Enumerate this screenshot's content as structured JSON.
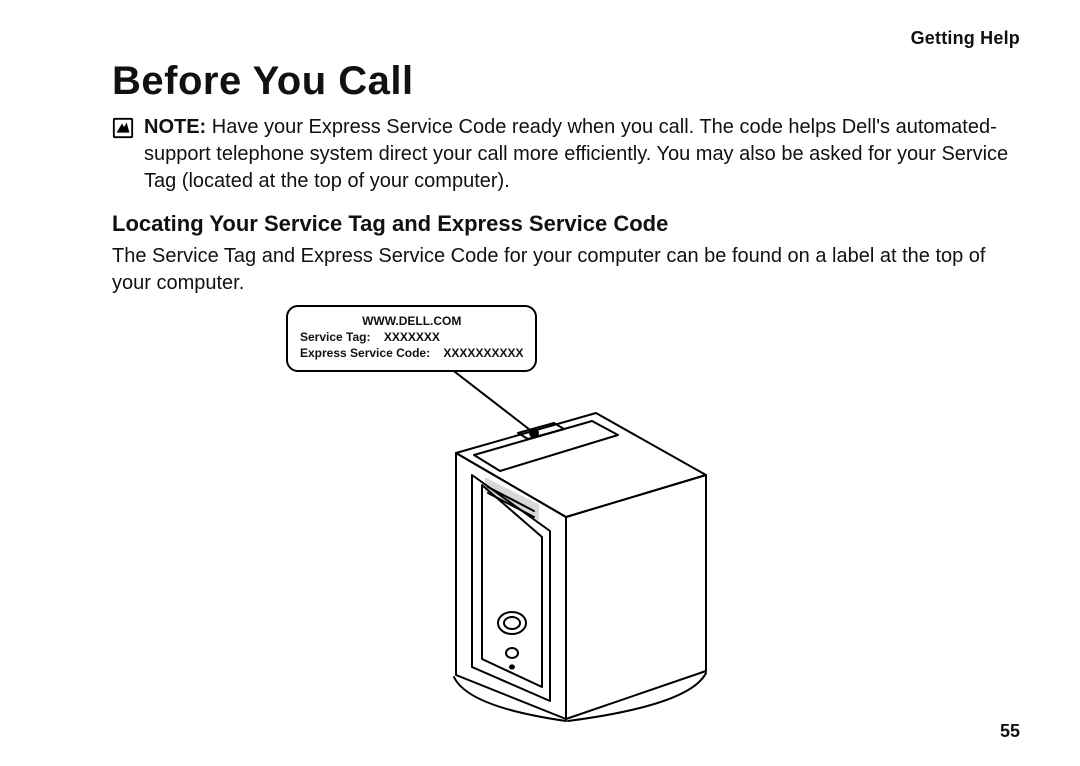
{
  "header": {
    "running_head": "Getting Help"
  },
  "title": "Before You Call",
  "note": {
    "label": "NOTE:",
    "text": "Have your Express Service Code ready when you call. The code helps Dell's automated-support telephone system direct your call more efficiently. You may also be asked for your Service Tag (located at the top of your computer)."
  },
  "subhead": "Locating Your Service Tag and Express Service Code",
  "body": "The Service Tag and Express Service Code for your computer can be found on a label at the top of your computer.",
  "callout": {
    "url": "WWW.DELL.COM",
    "service_tag_label": "Service Tag:",
    "service_tag_value": "XXXXXXX",
    "esc_label": "Express Service Code:",
    "esc_value": "XXXXXXXXXX"
  },
  "page_number": "55"
}
